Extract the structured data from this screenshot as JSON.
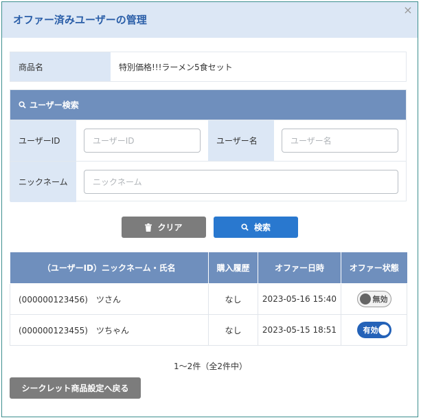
{
  "modal": {
    "title": "オファー済みユーザーの管理",
    "close_icon": "×"
  },
  "product": {
    "label": "商品名",
    "value": "特別価格!!!ラーメン5食セット"
  },
  "search": {
    "header_label": "ユーザー検索",
    "header_icon": "search-icon",
    "user_id_label": "ユーザーID",
    "user_id_placeholder": "ユーザーID",
    "user_id_value": "",
    "user_name_label": "ユーザー名",
    "user_name_placeholder": "ユーザー名",
    "user_name_value": "",
    "nickname_label": "ニックネーム",
    "nickname_placeholder": "ニックネーム",
    "nickname_value": ""
  },
  "buttons": {
    "clear_label": "クリア",
    "clear_icon": "trash-icon",
    "search_label": "検索",
    "search_icon": "search-icon",
    "back_label": "シークレット商品設定へ戻る"
  },
  "table": {
    "headers": [
      "（ユーザーID）ニックネーム・氏名",
      "購入履歴",
      "オファー日時",
      "オファー状態"
    ],
    "rows": [
      {
        "name": "(000000123456)　ツさん",
        "purchase": "なし",
        "offer_date": "2023-05-16 15:40",
        "status": "無効",
        "enabled": false
      },
      {
        "name": "(000000123455)　ツちゃん",
        "purchase": "なし",
        "offer_date": "2023-05-15 18:51",
        "status": "有効",
        "enabled": true
      }
    ]
  },
  "pagination": {
    "text": "1〜2件（全2件中）"
  },
  "colors": {
    "header_bg": "#dce7f5",
    "title": "#2a5ea8",
    "table_header": "#6f8fbd",
    "primary": "#2978cf",
    "secondary": "#7c7c7c",
    "toggle_on": "#2462b8"
  }
}
